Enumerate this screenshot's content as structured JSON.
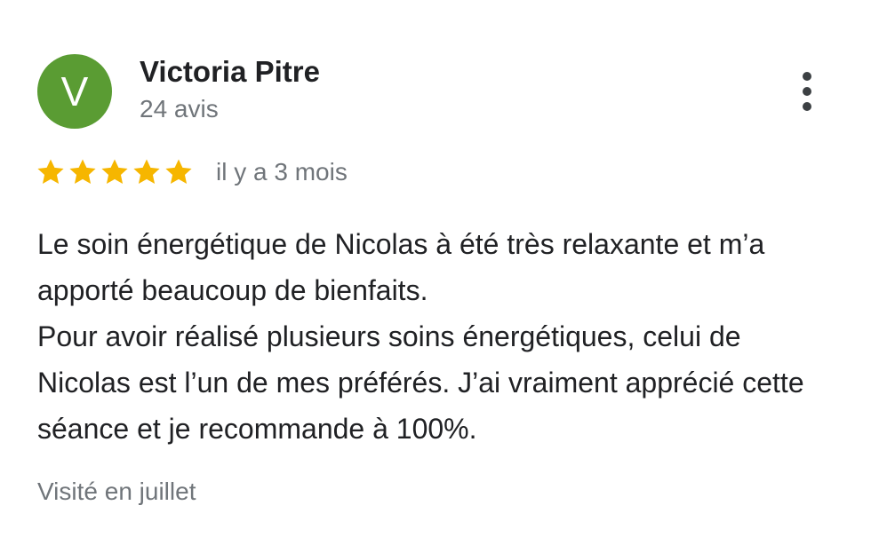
{
  "author": {
    "initial": "V",
    "name": "Victoria Pitre",
    "review_count": "24 avis",
    "avatar_color": "#5a9c33"
  },
  "rating": {
    "stars": 5,
    "max_stars": 5,
    "star_color": "#f6b600",
    "date": "il y a 3 mois"
  },
  "review": {
    "paragraphs": [
      "Le soin énergétique de Nicolas à été très relaxante et m’a apporté beaucoup de bienfaits.",
      "Pour avoir réalisé plusieurs soins énergétiques, celui de Nicolas est l’un de mes préférés. J’ai vraiment apprécié cette séance et je recommande à 100%."
    ]
  },
  "visit": {
    "label": "Visité en juillet"
  },
  "menu": {
    "icon": "more-vert-icon"
  }
}
